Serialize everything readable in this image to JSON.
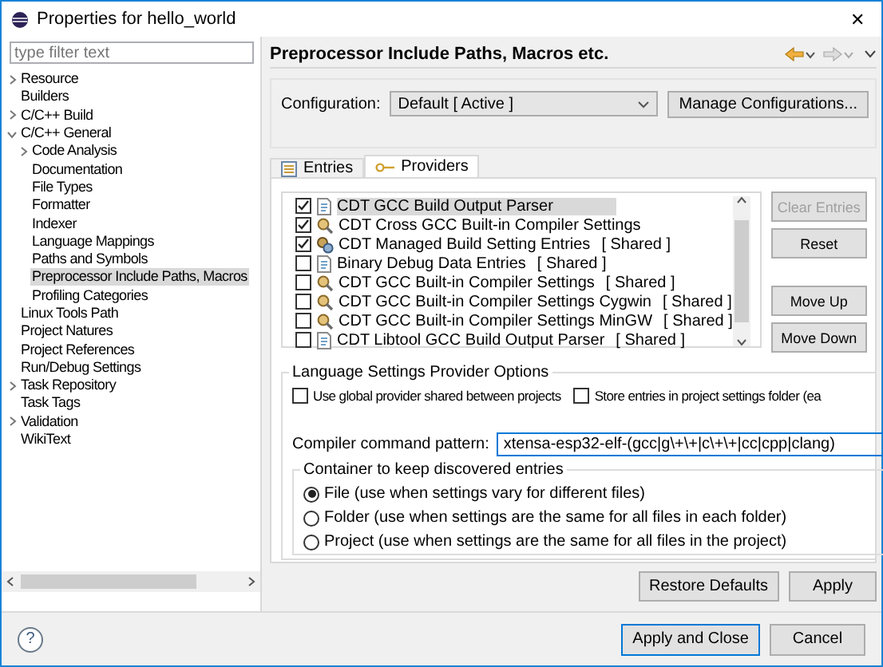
{
  "window": {
    "title": "Properties for hello_world",
    "close": "✕"
  },
  "sidebar": {
    "filter": {
      "placeholder": "type filter text"
    },
    "items": [
      {
        "label": "Resource",
        "kind": "group",
        "expanded": false,
        "selected": false
      },
      {
        "label": "Builders",
        "kind": "page",
        "selected": false
      },
      {
        "label": "C/C++ Build",
        "kind": "group",
        "expanded": false,
        "selected": false
      },
      {
        "label": "C/C++ General",
        "kind": "group",
        "expanded": true,
        "selected": false,
        "children": [
          {
            "label": "Code Analysis",
            "kind": "group",
            "expanded": false,
            "selected": false
          },
          {
            "label": "Documentation",
            "kind": "page",
            "selected": false
          },
          {
            "label": "File Types",
            "kind": "page",
            "selected": false
          },
          {
            "label": "Formatter",
            "kind": "page",
            "selected": false
          },
          {
            "label": "Indexer",
            "kind": "page",
            "selected": false
          },
          {
            "label": "Language Mappings",
            "kind": "page",
            "selected": false
          },
          {
            "label": "Paths and Symbols",
            "kind": "page",
            "selected": false
          },
          {
            "label": "Preprocessor Include Paths, Macros",
            "kind": "page",
            "selected": true
          },
          {
            "label": "Profiling Categories",
            "kind": "page",
            "selected": false
          }
        ]
      },
      {
        "label": "Linux Tools Path",
        "kind": "page",
        "selected": false
      },
      {
        "label": "Project Natures",
        "kind": "page",
        "selected": false
      },
      {
        "label": "Project References",
        "kind": "page",
        "selected": false
      },
      {
        "label": "Run/Debug Settings",
        "kind": "page",
        "selected": false
      },
      {
        "label": "Task Repository",
        "kind": "group",
        "expanded": false,
        "selected": false
      },
      {
        "label": "Task Tags",
        "kind": "page",
        "selected": false
      },
      {
        "label": "Validation",
        "kind": "group",
        "expanded": false,
        "selected": false
      },
      {
        "label": "WikiText",
        "kind": "page",
        "selected": false
      }
    ]
  },
  "page": {
    "title": "Preprocessor Include Paths, Macros etc.",
    "configuration": {
      "label": "Configuration:",
      "value": "Default  [ Active ]",
      "button": "Manage Configurations..."
    },
    "tabs": [
      {
        "label": "Entries",
        "selected": false
      },
      {
        "label": "Providers",
        "selected": true
      }
    ],
    "providers": [
      {
        "label": "CDT GCC Build Output Parser",
        "kind": "parser",
        "checked": true,
        "selected": true
      },
      {
        "label": "CDT Cross GCC Built-in Compiler Settings",
        "kind": "builtin",
        "checked": true,
        "selected": false
      },
      {
        "label": "CDT Managed Build Setting Entries",
        "shared": "[ Shared ]",
        "kind": "managed",
        "checked": true,
        "selected": false
      },
      {
        "label": "Binary Debug Data Entries",
        "shared": "[ Shared ]",
        "kind": "parser",
        "checked": false,
        "selected": false
      },
      {
        "label": "CDT GCC Built-in Compiler Settings",
        "shared": "[ Shared ]",
        "kind": "builtin",
        "checked": false,
        "selected": false
      },
      {
        "label": "CDT GCC Built-in Compiler Settings Cygwin",
        "shared": "[ Shared ]",
        "kind": "builtin",
        "checked": false,
        "selected": false
      },
      {
        "label": "CDT GCC Built-in Compiler Settings MinGW",
        "shared": "[ Shared ]",
        "kind": "builtin",
        "checked": false,
        "selected": false
      },
      {
        "label": "CDT Libtool GCC Build Output Parser",
        "shared": "[ Shared ]",
        "kind": "parser",
        "checked": false,
        "selected": false
      }
    ],
    "side_buttons": [
      {
        "label": "Clear Entries",
        "disabled": true
      },
      {
        "label": "Reset",
        "disabled": false
      },
      {
        "label": "Move Up",
        "disabled": false
      },
      {
        "label": "Move Down",
        "disabled": false
      }
    ],
    "options": {
      "title": "Language Settings Provider Options",
      "checkboxes": [
        {
          "label": "Use global provider shared between projects",
          "checked": false
        },
        {
          "label": "Store entries in project settings folder (ea",
          "checked": false
        }
      ],
      "pattern": {
        "label": "Compiler command pattern:",
        "value": "xtensa-esp32-elf-(gcc|g\\+\\+|c\\+\\+|cc|cpp|clang)"
      },
      "container": {
        "title": "Container to keep discovered entries",
        "radios": [
          {
            "label": "File (use when settings vary for different files)",
            "selected": true
          },
          {
            "label": "Folder (use when settings are the same for all files in each folder)",
            "selected": false
          },
          {
            "label": "Project (use when settings are the same for all files in the project)",
            "selected": false
          }
        ]
      }
    },
    "buttons": [
      "Restore Defaults",
      "Apply"
    ]
  },
  "footer": {
    "help": "?",
    "buttons": [
      {
        "label": "Apply and Close",
        "default": true
      },
      {
        "label": "Cancel",
        "default": false
      }
    ]
  }
}
